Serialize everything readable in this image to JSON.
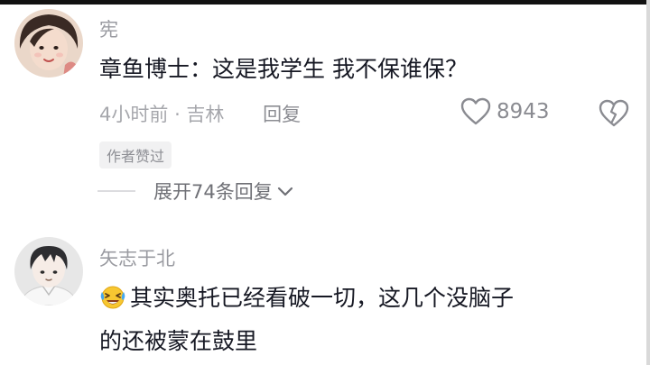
{
  "comments": [
    {
      "username": "宪",
      "text": "章鱼博士：这是我学生 我不保谁保？",
      "time": "4小时前",
      "location": "吉林",
      "reply_label": "回复",
      "likes": "8943",
      "author_badge": "作者赞过",
      "expand_label": "展开74条回复",
      "avatar_icon": "woman-avatar"
    },
    {
      "username": "矢志于北",
      "emoji_icon": "laughing-crying-emoji",
      "text_line1": "其实奥托已经看破一切，这几个没脑子",
      "text_line2": "的还被蒙在鼓里",
      "avatar_icon": "anime-boy-avatar"
    }
  ],
  "colors": {
    "text_primary": "#161823",
    "text_secondary": "#9a9ba1",
    "badge_bg": "#f1f1f2"
  }
}
